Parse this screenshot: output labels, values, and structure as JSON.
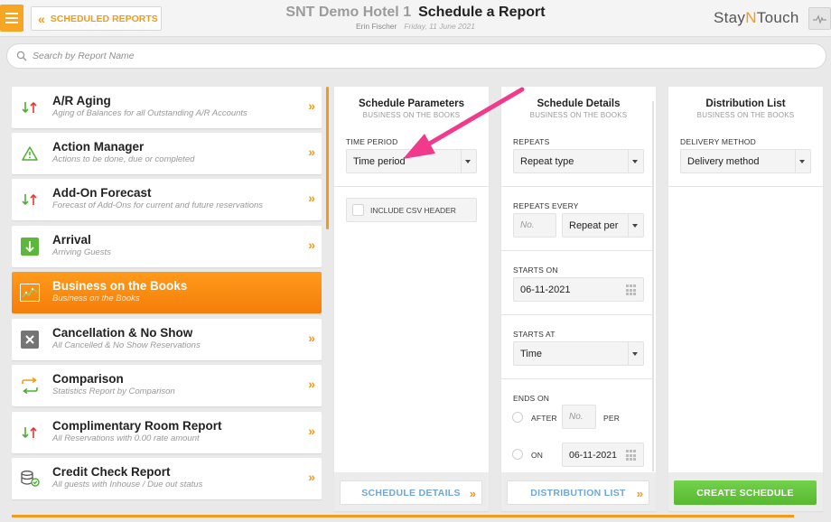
{
  "header": {
    "back_label": "SCHEDULED REPORTS",
    "hotel_name": "SNT Demo Hotel 1",
    "page_title": "Schedule a Report",
    "user_name": "Erin Fischer",
    "date": "Friday, 11 June 2021",
    "logo_pre": "Stay",
    "logo_n": "N",
    "logo_post": "Touch"
  },
  "search": {
    "placeholder": "Search by Report Name"
  },
  "colors": {
    "accent": "#f29a1b",
    "active_row": "#f7890e",
    "create_green": "#5cbd34",
    "link_blue": "#6fa7d8"
  },
  "reports": [
    {
      "name": "A/R Aging",
      "desc": "Aging of Balances for all Outstanding A/R Accounts",
      "icon": "up-down-arrows-icon"
    },
    {
      "name": "Action Manager",
      "desc": "Actions to be done, due or completed",
      "icon": "warning-triangle-icon"
    },
    {
      "name": "Add-On Forecast",
      "desc": "Forecast of Add-Ons for current and future reservations",
      "icon": "up-down-arrows-icon"
    },
    {
      "name": "Arrival",
      "desc": "Arriving Guests",
      "icon": "arrival-down-arrow-icon"
    },
    {
      "name": "Business on the Books",
      "desc": "Business on the Books",
      "icon": "trend-chart-icon",
      "active": true
    },
    {
      "name": "Cancellation & No Show",
      "desc": "All Cancelled & No Show Reservations",
      "icon": "cancel-x-icon"
    },
    {
      "name": "Comparison",
      "desc": "Statistics Report by Comparison",
      "icon": "swap-arrows-icon"
    },
    {
      "name": "Complimentary Room Report",
      "desc": "All Reservations with 0.00 rate amount",
      "icon": "up-down-arrows-icon"
    },
    {
      "name": "Credit Check Report",
      "desc": "All guests with Inhouse / Due out status",
      "icon": "coins-icon"
    }
  ],
  "params": {
    "title": "Schedule Parameters",
    "subtitle": "BUSINESS ON THE BOOKS",
    "time_period_label": "TIME PERIOD",
    "time_period_value": "Time period",
    "csv_label": "INCLUDE CSV HEADER",
    "footer_button": "SCHEDULE DETAILS"
  },
  "details": {
    "title": "Schedule Details",
    "subtitle": "BUSINESS ON THE BOOKS",
    "repeats_label": "REPEATS",
    "repeats_value": "Repeat type",
    "repeats_every_label": "REPEATS EVERY",
    "repeats_every_placeholder": "No.",
    "repeat_per_value": "Repeat per",
    "starts_on_label": "STARTS ON",
    "starts_on_value": "06-11-2021",
    "starts_at_label": "STARTS AT",
    "starts_at_value": "Time",
    "ends_on_label": "ENDS ON",
    "after_label": "AFTER",
    "after_placeholder": "No.",
    "per_label": "PER",
    "on_label": "ON",
    "ends_on_date": "06-11-2021",
    "footer_button": "DISTRIBUTION LIST"
  },
  "distribution": {
    "title": "Distribution List",
    "subtitle": "BUSINESS ON THE BOOKS",
    "delivery_label": "DELIVERY METHOD",
    "delivery_value": "Delivery method",
    "create_button": "CREATE SCHEDULE"
  }
}
